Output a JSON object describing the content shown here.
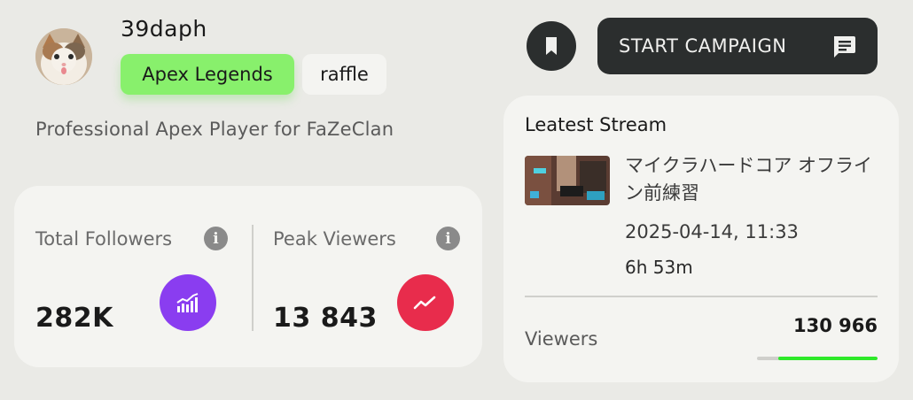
{
  "profile": {
    "username": "39daph",
    "tags": [
      "Apex Legends",
      "raffle"
    ],
    "bio": "Professional Apex Player for FaZeClan",
    "avatar_icon": "cat-avatar"
  },
  "stats": {
    "followers": {
      "label": "Total Followers",
      "value": "282K",
      "badge_color": "#8a3df0",
      "icon": "bar-chart-trend-icon"
    },
    "viewers": {
      "label": "Peak Viewers",
      "value": "13 843",
      "badge_color": "#e82c4c",
      "icon": "trend-up-icon"
    }
  },
  "actions": {
    "bookmark_icon": "bookmark-icon",
    "campaign_label": "START CAMPAIGN",
    "campaign_icon": "chat-icon"
  },
  "stream": {
    "heading": "Leatest Stream",
    "title": "マイクラハードコア オフライン前練習",
    "date": "2025-04-14, 11:33",
    "duration": "6h 53m",
    "viewers_label": "Viewers",
    "viewers_value": "130 966",
    "viewers_progress": 0.82,
    "progress_color": "#2ee92a"
  }
}
